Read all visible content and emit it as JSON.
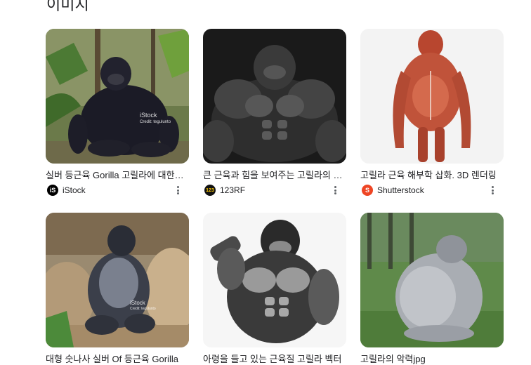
{
  "section": {
    "title": "이미지"
  },
  "results": [
    {
      "caption": "실버 등근육 Gorilla 고릴라에 대한 스톡 사진",
      "source": "iStock",
      "favicon_text": "iS",
      "favicon_color": "#000000",
      "watermark": "iStock",
      "watermark_sub": "Credit: tegulunto"
    },
    {
      "caption": "큰 근육과 힘을 보여주는 고릴라의 이미지",
      "source": "123RF",
      "favicon_text": "123",
      "favicon_color": "#111111"
    },
    {
      "caption": "고릴라 근육 해부학 삽화. 3D 렌더링",
      "source": "Shutterstock",
      "favicon_text": "S",
      "favicon_color": "#ee4524"
    },
    {
      "caption": "대형 숫나사 실버 Of 등근육 Gorilla",
      "watermark": "iStock",
      "watermark_sub": "Credit: tegulunto"
    },
    {
      "caption": "아령을 들고 있는 근육질 고릴라 벡터"
    },
    {
      "caption": "고릴라의 악력jpg"
    }
  ]
}
